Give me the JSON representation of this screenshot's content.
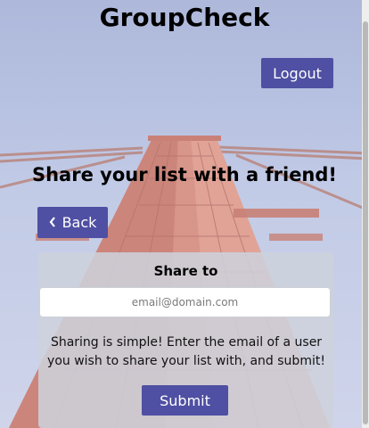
{
  "app": {
    "title": "GroupCheck"
  },
  "header": {
    "logout_label": "Logout"
  },
  "page": {
    "heading": "Share your list with a friend!",
    "back_label": "Back",
    "back_icon": "chevron-left-icon"
  },
  "share_card": {
    "title": "Share to",
    "email_value": "",
    "email_placeholder": "email@domain.com",
    "description": "Sharing is simple! Enter the email of a user you wish to share your list with, and submit!",
    "submit_label": "Submit"
  },
  "colors": {
    "button": "#4f4fa3",
    "button_text": "#ffffff",
    "card_background": "#cdd2dc"
  }
}
